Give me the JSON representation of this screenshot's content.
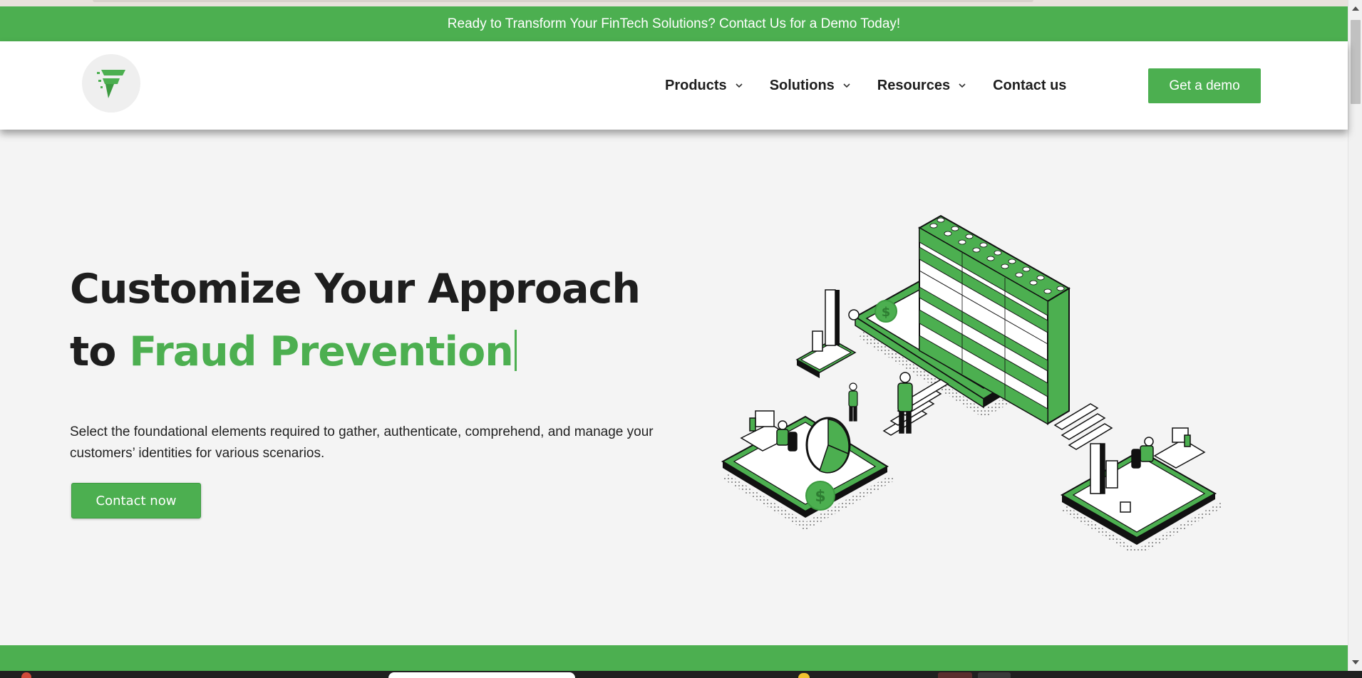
{
  "announcement": {
    "text": "Ready to Transform Your FinTech Solutions? Contact Us for a Demo Today!"
  },
  "nav": {
    "items": [
      {
        "label": "Products",
        "has_dropdown": true
      },
      {
        "label": "Solutions",
        "has_dropdown": true
      },
      {
        "label": "Resources",
        "has_dropdown": true
      },
      {
        "label": "Contact us",
        "has_dropdown": false
      }
    ],
    "cta_label": "Get a demo"
  },
  "hero": {
    "title_line1": "Customize Your Approach",
    "title_prefix": "to",
    "title_accent": "Fraud Prevention",
    "description": "Select the foundational elements required to gather, authenticate, comprehend, and manage your customers’ identities for various scenarios.",
    "cta_label": "Contact now"
  },
  "colors": {
    "brand_green": "#4caf50",
    "text_dark": "#1e1e1e",
    "background": "#f4f4f4"
  },
  "icons": {
    "logo": "f-logo-icon",
    "dropdown": "chevron-down-icon",
    "illustration": "isometric-office-illustration"
  }
}
